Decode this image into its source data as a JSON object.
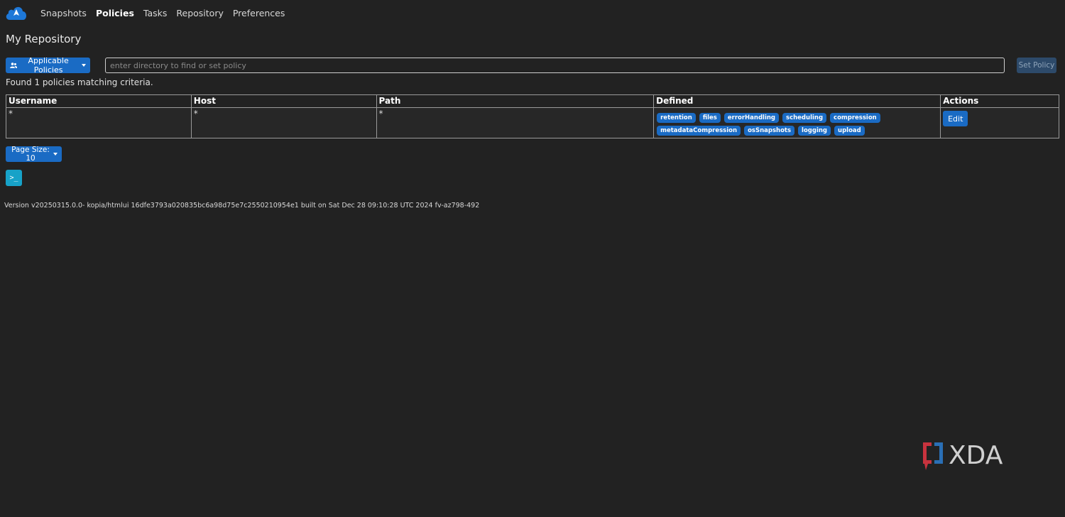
{
  "navbar": {
    "items": [
      {
        "label": "Snapshots",
        "active": false
      },
      {
        "label": "Policies",
        "active": true
      },
      {
        "label": "Tasks",
        "active": false
      },
      {
        "label": "Repository",
        "active": false
      },
      {
        "label": "Preferences",
        "active": false
      }
    ]
  },
  "page": {
    "title": "My Repository"
  },
  "toolbar": {
    "applicable_label": "Applicable Policies",
    "directory_placeholder": "enter directory to find or set policy",
    "set_policy_label": "Set Policy"
  },
  "results": {
    "found_text": "Found 1 policies matching criteria."
  },
  "table": {
    "headers": [
      "Username",
      "Host",
      "Path",
      "Defined",
      "Actions"
    ],
    "rows": [
      {
        "username": "*",
        "host": "*",
        "path": "*",
        "defined": [
          "retention",
          "files",
          "errorHandling",
          "scheduling",
          "compression",
          "metadataCompression",
          "osSnapshots",
          "logging",
          "upload"
        ],
        "action_label": "Edit"
      }
    ]
  },
  "pagination": {
    "page_size_label": "Page Size: 10"
  },
  "terminal": {
    "label": ">_"
  },
  "footer": {
    "version": "Version v20250315.0.0- kopia/htmlui 16dfe3793a020835bc6a98d75e7c2550210954e1 built on Sat Dec 28 09:10:28 UTC 2024 fv-az798-492"
  },
  "watermark": {
    "text": "XDA"
  },
  "colors": {
    "background": "#222222",
    "primary": "#1a6bc4",
    "info": "#17a2c8"
  }
}
